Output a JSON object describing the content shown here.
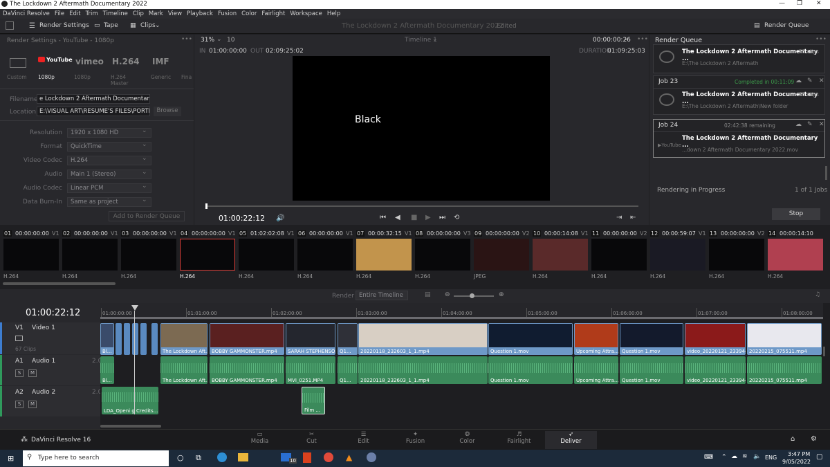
{
  "window": {
    "title": "The Lockdown 2 Aftermath Documentary 2022"
  },
  "menu": [
    "DaVinci Resolve",
    "File",
    "Edit",
    "Trim",
    "Timeline",
    "Clip",
    "Mark",
    "View",
    "Playback",
    "Fusion",
    "Color",
    "Fairlight",
    "Workspace",
    "Help"
  ],
  "toolbar": {
    "render_settings": "Render Settings",
    "tape": "Tape",
    "clips": "Clips",
    "project_title": "The Lockdown 2 Aftermath Documentary 2022",
    "edited": "Edited",
    "render_queue": "Render Queue"
  },
  "render_settings": {
    "header": "Render Settings - YouTube - 1080p",
    "presets": [
      {
        "name": "Custom",
        "logo": ""
      },
      {
        "name": "1080p",
        "logo": "YouTube"
      },
      {
        "name": "1080p",
        "logo": "vimeo"
      },
      {
        "name": "H.264 Master",
        "logo": "H.264"
      },
      {
        "name": "Generic",
        "logo": "IMF"
      },
      {
        "name": "Fina",
        "logo": ""
      }
    ],
    "filename_label": "Filename",
    "filename": "e Lockdown 2 Aftermath Documentary 2022",
    "location_label": "Location",
    "location": "E:\\VISUAL ART\\RESUME'S FILES\\PORTFOLIO",
    "browse": "Browse",
    "rows": [
      {
        "label": "Resolution",
        "value": "1920 x 1080 HD"
      },
      {
        "label": "Format",
        "value": "QuickTime"
      },
      {
        "label": "Video Codec",
        "value": "H.264"
      },
      {
        "label": "Audio",
        "value": "Main 1 (Stereo)"
      },
      {
        "label": "Audio Codec",
        "value": "Linear PCM"
      },
      {
        "label": "Data Burn-In",
        "value": "Same as project"
      }
    ],
    "add_button": "Add to Render Queue"
  },
  "viewer": {
    "zoom": "31%",
    "zoom2": "10",
    "timeline_name": "Timeline 1",
    "tc_top": "00:00:00:26",
    "in_label": "IN",
    "in": "01:00:00:00",
    "out_label": "OUT",
    "out": "02:09:25:02",
    "duration_label": "DURATION",
    "duration": "01:09:25:03",
    "overlay_text": "Black",
    "timecode": "01:00:22:12"
  },
  "render_queue": {
    "title": "Render Queue",
    "jobs": [
      {
        "job": "",
        "status": "",
        "title": "The Lockdown 2 Aftermath Documentary ...",
        "clips": "55 clips",
        "path": "E:\\The Lockdown 2 Aftermath"
      },
      {
        "job": "Job 23",
        "status": "Completed in 00:11:09",
        "title": "The Lockdown 2 Aftermath Documentary ...",
        "clips": "55 clips",
        "path": "E:\\The Lockdown 2 Aftermath\\New folder"
      },
      {
        "job": "Job 24",
        "status": "02:42:38 remaining",
        "title": "The Lockdown 2 Aftermath Documentary ...",
        "clips": "",
        "path": "...down 2 Aftermath Documentary 2022.mov"
      }
    ],
    "progress_label": "Rendering in Progress",
    "progress_count": "1 of 1 Jobs",
    "stop": "Stop"
  },
  "clips": [
    {
      "num": "01",
      "tc": "00:00:00:00",
      "track": "V1",
      "codec": "H.264"
    },
    {
      "num": "02",
      "tc": "00:00:00:00",
      "track": "V1",
      "codec": "H.264"
    },
    {
      "num": "03",
      "tc": "00:00:00:00",
      "track": "V1",
      "codec": "H.264"
    },
    {
      "num": "04",
      "tc": "00:00:00:00",
      "track": "V1",
      "codec": "H.264"
    },
    {
      "num": "05",
      "tc": "01:02:02:08",
      "track": "V1",
      "codec": "H.264"
    },
    {
      "num": "06",
      "tc": "00:00:00:00",
      "track": "V1",
      "codec": "H.264"
    },
    {
      "num": "07",
      "tc": "00:00:32:15",
      "track": "V1",
      "codec": "H.264"
    },
    {
      "num": "08",
      "tc": "00:00:00:00",
      "track": "V3",
      "codec": "H.264"
    },
    {
      "num": "09",
      "tc": "00:00:00:00",
      "track": "V2",
      "codec": "JPEG"
    },
    {
      "num": "10",
      "tc": "00:00:14:08",
      "track": "V1",
      "codec": "H.264"
    },
    {
      "num": "11",
      "tc": "00:00:00:00",
      "track": "V2",
      "codec": "H.264"
    },
    {
      "num": "12",
      "tc": "00:00:59:07",
      "track": "V1",
      "codec": "H.264"
    },
    {
      "num": "13",
      "tc": "00:00:00:00",
      "track": "V2",
      "codec": "H.264"
    },
    {
      "num": "14",
      "tc": "00:00:14:10",
      "track": "",
      "codec": "H.264"
    }
  ],
  "timeline": {
    "timecode": "01:00:22:12",
    "clips_count": "67 Clips",
    "render_label": "Render",
    "render_option": "Entire Timeline",
    "ruler": [
      "01:00:00:00",
      "01:01:00:00",
      "01:02:00:00",
      "01:03:00:00",
      "01:04:00:00",
      "01:05:00:00",
      "01:06:00:00",
      "01:07:00:00",
      "01:08:00:00"
    ],
    "v1": {
      "id": "V1",
      "name": "Video 1"
    },
    "a1": {
      "id": "A1",
      "name": "Audio 1",
      "level": "2.0"
    },
    "a2": {
      "id": "A2",
      "name": "Audio 2",
      "level": "2.0"
    },
    "video_clips": [
      "Bl...",
      "The Lockdown Aft...",
      "BOBBY GAMMONSTER.mp4",
      "SARAH STEPHENSO...",
      "Q1...",
      "20220118_232603_1_1.mp4",
      "Question 1.mov",
      "Upcoming Attra...",
      "Question 1.mov",
      "video_20220121_233944...",
      "20220215_075511.mp4"
    ],
    "audio1_clips": [
      "Bl...",
      "The Lockdown Aft...",
      "BOBBY GAMMONSTER.mp4",
      "MVI_0251.MP4",
      "Q1...",
      "20220118_232603_1_1.mp4",
      "Question 1.mov",
      "Upcoming Attra...",
      "Question 1.mov",
      "video_20220121_233944...",
      "20220215_075511.mp4"
    ],
    "audio2_clips": [
      "LDA_Openi g Credits...",
      "Film ..."
    ]
  },
  "bottom": {
    "app": "DaVinci Resolve 16",
    "pages": [
      "Media",
      "Cut",
      "Edit",
      "Fusion",
      "Color",
      "Fairlight",
      "Deliver"
    ],
    "active": "Deliver"
  },
  "taskbar": {
    "search": "Type here to search",
    "lang": "ENG",
    "time": "3:47 PM",
    "date": "9/05/2022",
    "badge": "10"
  }
}
